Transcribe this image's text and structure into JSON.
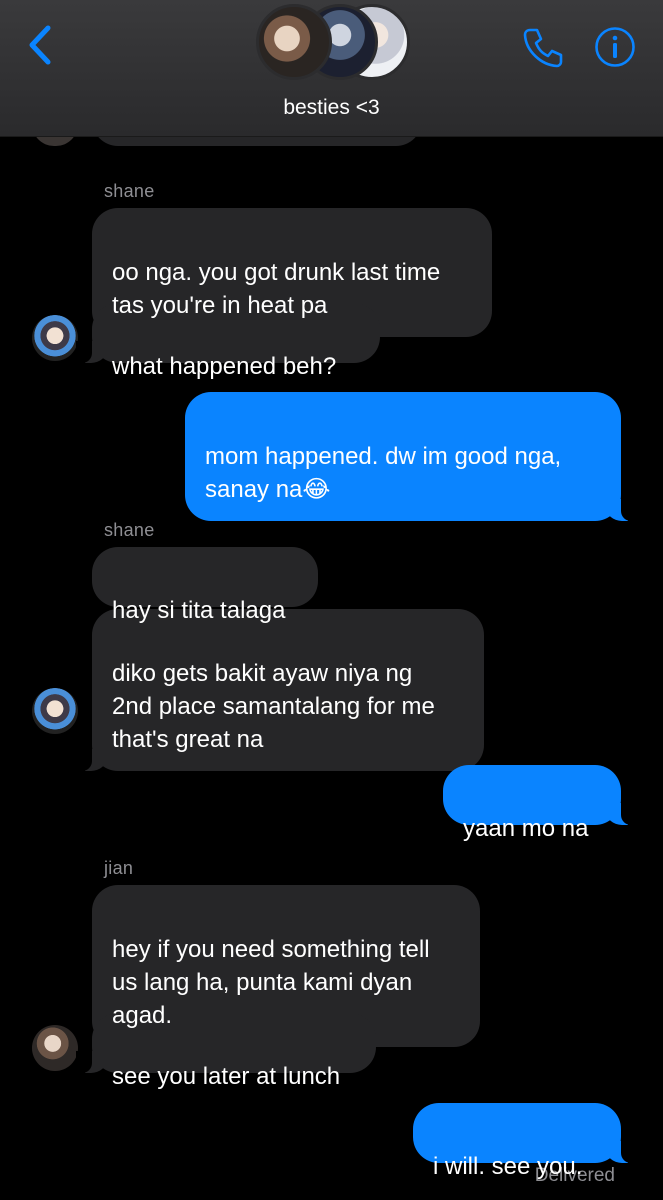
{
  "header": {
    "group_name": "besties <3",
    "back_icon": "chevron-left-icon",
    "call_icon": "phone-icon",
    "info_icon": "info-icon",
    "accent_color": "#0a84ff"
  },
  "messages": [
    {
      "sender": "shane"
    },
    {
      "direction": "incoming",
      "text": "oo nga. you got drunk last time\ntas you're in heat pa"
    },
    {
      "direction": "incoming",
      "text": "what happened beh?"
    },
    {
      "direction": "outgoing",
      "text": "mom happened. dw im good nga,\nsanay na😂"
    },
    {
      "sender": "shane"
    },
    {
      "direction": "incoming",
      "text": "hay si tita talaga"
    },
    {
      "direction": "incoming",
      "text": "diko gets bakit ayaw niya ng\n2nd place samantalang for me\nthat's great na"
    },
    {
      "direction": "outgoing",
      "text": "yaan mo na"
    },
    {
      "sender": "jian"
    },
    {
      "direction": "incoming",
      "text": "hey if you need something tell\nus lang ha, punta kami dyan\nagad."
    },
    {
      "direction": "incoming",
      "text": "see you later at lunch"
    },
    {
      "direction": "outgoing",
      "text": "i will. see you."
    }
  ],
  "status": "Delivered"
}
